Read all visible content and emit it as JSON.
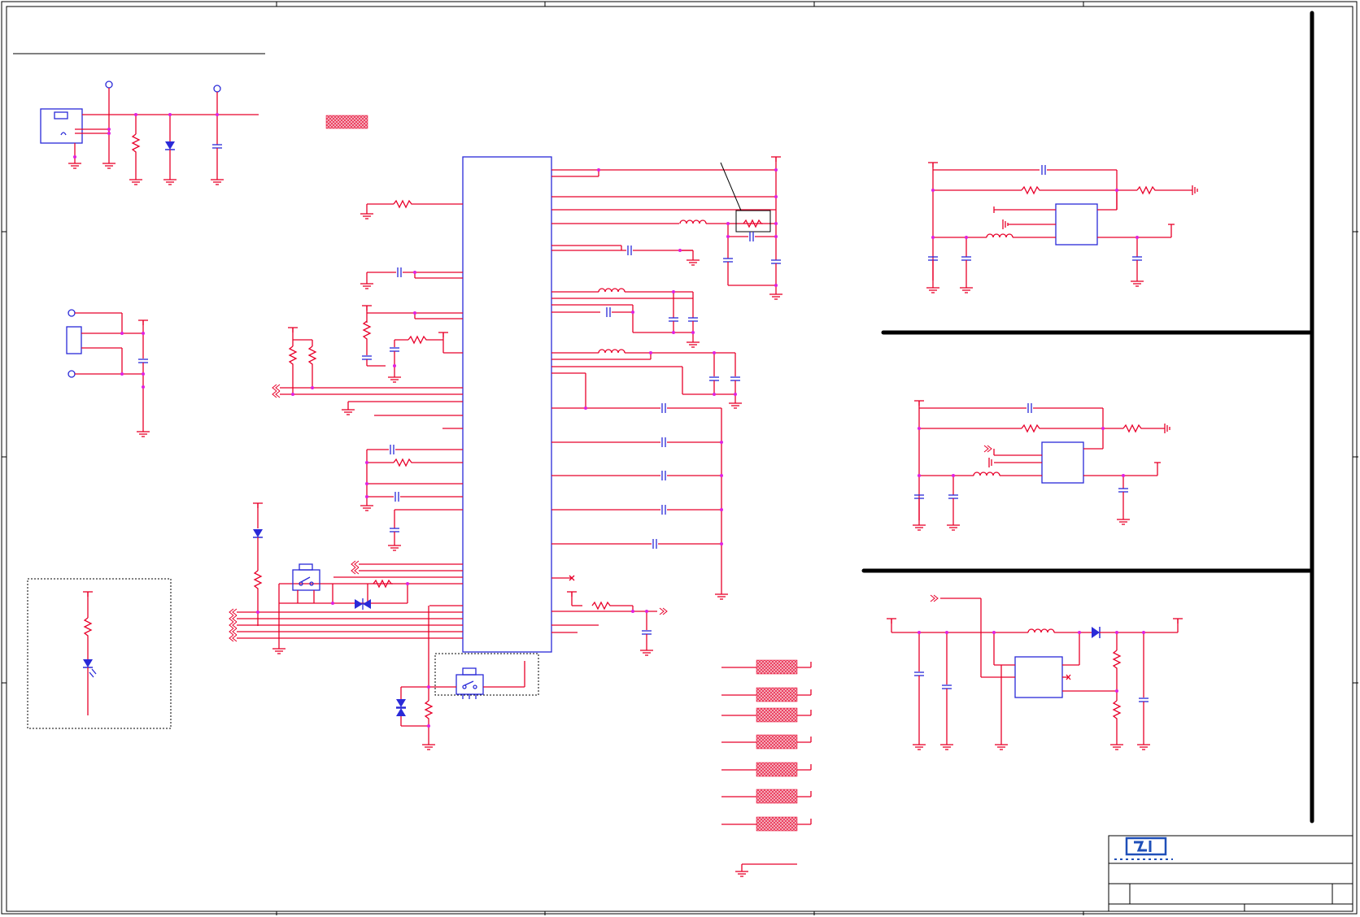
{
  "sheet": {
    "title_block": {
      "logo": "logo-icon",
      "logo_text": "",
      "title": "",
      "sheet_number": ""
    },
    "colors": {
      "wire": "#e8002a",
      "component": "#2a2ad8",
      "junction": "#e020e0",
      "border": "#000000"
    }
  }
}
